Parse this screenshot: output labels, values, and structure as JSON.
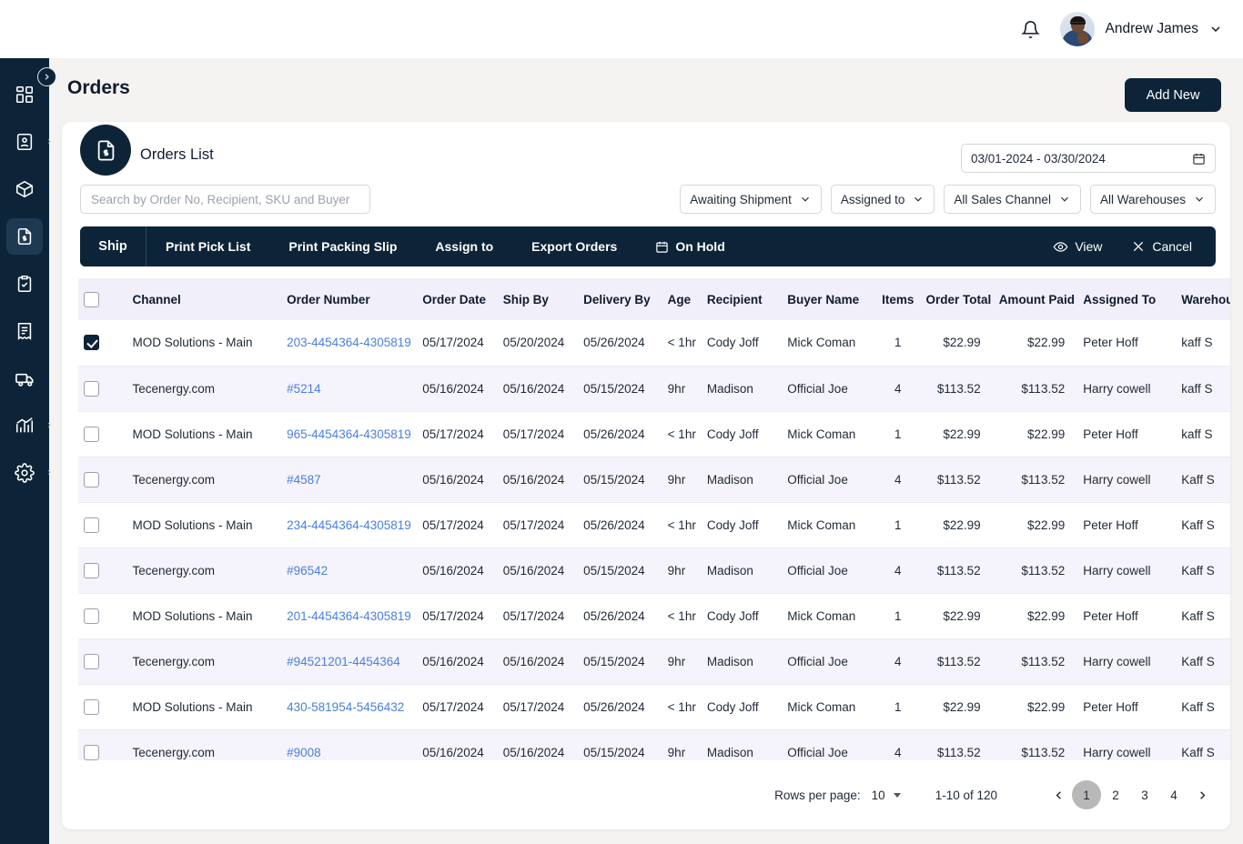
{
  "topbar": {
    "bell_icon": "bell-icon",
    "user_name": "Andrew James",
    "chevron_icon": "chevron-down-icon"
  },
  "sidebar": {
    "collapse_icon": "chevron-right-icon",
    "items": [
      {
        "icon": "dashboard-grid-icon",
        "active": false,
        "expandable": false
      },
      {
        "icon": "contact-card-icon",
        "active": false,
        "expandable": true
      },
      {
        "icon": "box-package-icon",
        "active": false,
        "expandable": false
      },
      {
        "icon": "invoice-document-icon",
        "active": true,
        "expandable": false
      },
      {
        "icon": "clipboard-check-icon",
        "active": false,
        "expandable": false
      },
      {
        "icon": "receipt-list-icon",
        "active": false,
        "expandable": false
      },
      {
        "icon": "delivery-truck-icon",
        "active": false,
        "expandable": false
      },
      {
        "icon": "analytics-chart-icon",
        "active": false,
        "expandable": true
      },
      {
        "icon": "gear-settings-icon",
        "active": false,
        "expandable": true
      }
    ]
  },
  "page": {
    "title": "Orders",
    "add_new_label": "Add New"
  },
  "card": {
    "icon": "orders-document-icon",
    "title": "Orders List",
    "date_range": "03/01-2024 - 03/30/2024",
    "calendar_icon": "calendar-icon"
  },
  "search": {
    "placeholder": "Search by Order No, Recipient, SKU and Buyer",
    "value": ""
  },
  "filters": [
    {
      "label": "Awaiting Shipment",
      "icon": "chevron-down-icon"
    },
    {
      "label": "Assigned to",
      "icon": "chevron-down-icon"
    },
    {
      "label": "All Sales Channel",
      "icon": "chevron-down-icon"
    },
    {
      "label": "All Warehouses",
      "icon": "chevron-down-icon"
    }
  ],
  "toolbar": {
    "ship_label": "Ship",
    "actions": [
      {
        "label": "Print Pick List",
        "icon": null
      },
      {
        "label": "Print Packing Slip",
        "icon": null
      },
      {
        "label": "Assign to",
        "icon": null
      },
      {
        "label": "Export Orders",
        "icon": null
      },
      {
        "label": "On Hold",
        "icon": "calendar-icon"
      }
    ],
    "right_actions": [
      {
        "label": "View",
        "icon": "eye-icon"
      },
      {
        "label": "Cancel",
        "icon": "close-x-icon"
      }
    ]
  },
  "table": {
    "columns": [
      "Channel",
      "Order Number",
      "Order Date",
      "Ship By",
      "Delivery By",
      "Age",
      "Recipient",
      "Buyer Name",
      "Items",
      "Order Total",
      "Amount Paid",
      "Assigned To",
      "Warehouse"
    ],
    "header_checkbox_checked": false,
    "rows": [
      {
        "checked": true,
        "channel": "MOD Solutions - Main",
        "order_number": "203-4454364-4305819",
        "order_date": "05/17/2024",
        "ship_by": "05/20/2024",
        "delivery_by": "05/26/2024",
        "age": "< 1hr",
        "recipient": "Cody Joff",
        "buyer_name": "Mick Coman",
        "items": "1",
        "order_total": "$22.99",
        "amount_paid": "$22.99",
        "assigned_to": "Peter Hoff",
        "warehouse": "kaff S"
      },
      {
        "checked": false,
        "channel": "Tecenergy.com",
        "order_number": "#5214",
        "order_date": "05/16/2024",
        "ship_by": "05/16/2024",
        "delivery_by": "05/15/2024",
        "age": "9hr",
        "recipient": "Madison",
        "buyer_name": "Official Joe",
        "items": "4",
        "order_total": "$113.52",
        "amount_paid": "$113.52",
        "assigned_to": "Harry cowell",
        "warehouse": "kaff S"
      },
      {
        "checked": false,
        "channel": "MOD Solutions - Main",
        "order_number": "965-4454364-4305819",
        "order_date": "05/17/2024",
        "ship_by": "05/17/2024",
        "delivery_by": "05/26/2024",
        "age": "< 1hr",
        "recipient": "Cody Joff",
        "buyer_name": "Mick Coman",
        "items": "1",
        "order_total": "$22.99",
        "amount_paid": "$22.99",
        "assigned_to": "Peter Hoff",
        "warehouse": "kaff S"
      },
      {
        "checked": false,
        "channel": "Tecenergy.com",
        "order_number": "#4587",
        "order_date": "05/16/2024",
        "ship_by": "05/16/2024",
        "delivery_by": "05/15/2024",
        "age": "9hr",
        "recipient": "Madison",
        "buyer_name": "Official Joe",
        "items": "4",
        "order_total": "$113.52",
        "amount_paid": "$113.52",
        "assigned_to": "Harry cowell",
        "warehouse": "Kaff S"
      },
      {
        "checked": false,
        "channel": "MOD Solutions - Main",
        "order_number": "234-4454364-4305819",
        "order_date": "05/17/2024",
        "ship_by": "05/17/2024",
        "delivery_by": "05/26/2024",
        "age": "< 1hr",
        "recipient": "Cody Joff",
        "buyer_name": "Mick Coman",
        "items": "1",
        "order_total": "$22.99",
        "amount_paid": "$22.99",
        "assigned_to": "Peter Hoff",
        "warehouse": "Kaff S"
      },
      {
        "checked": false,
        "channel": "Tecenergy.com",
        "order_number": "#96542",
        "order_date": "05/16/2024",
        "ship_by": "05/16/2024",
        "delivery_by": "05/15/2024",
        "age": "9hr",
        "recipient": "Madison",
        "buyer_name": "Official Joe",
        "items": "4",
        "order_total": "$113.52",
        "amount_paid": "$113.52",
        "assigned_to": "Harry cowell",
        "warehouse": "Kaff S"
      },
      {
        "checked": false,
        "channel": "MOD Solutions - Main",
        "order_number": "201-4454364-4305819",
        "order_date": "05/17/2024",
        "ship_by": "05/17/2024",
        "delivery_by": "05/26/2024",
        "age": "< 1hr",
        "recipient": "Cody Joff",
        "buyer_name": "Mick Coman",
        "items": "1",
        "order_total": "$22.99",
        "amount_paid": "$22.99",
        "assigned_to": "Peter Hoff",
        "warehouse": "Kaff S"
      },
      {
        "checked": false,
        "channel": "Tecenergy.com",
        "order_number": "#94521201-4454364",
        "order_date": "05/16/2024",
        "ship_by": "05/16/2024",
        "delivery_by": "05/15/2024",
        "age": "9hr",
        "recipient": "Madison",
        "buyer_name": "Official Joe",
        "items": "4",
        "order_total": "$113.52",
        "amount_paid": "$113.52",
        "assigned_to": "Harry cowell",
        "warehouse": "Kaff S"
      },
      {
        "checked": false,
        "channel": "MOD Solutions - Main",
        "order_number": "430-581954-5456432",
        "order_date": "05/17/2024",
        "ship_by": "05/17/2024",
        "delivery_by": "05/26/2024",
        "age": "< 1hr",
        "recipient": "Cody Joff",
        "buyer_name": "Mick Coman",
        "items": "1",
        "order_total": "$22.99",
        "amount_paid": "$22.99",
        "assigned_to": "Peter Hoff",
        "warehouse": "Kaff S"
      },
      {
        "checked": false,
        "channel": "Tecenergy.com",
        "order_number": "#9008",
        "order_date": "05/16/2024",
        "ship_by": "05/16/2024",
        "delivery_by": "05/15/2024",
        "age": "9hr",
        "recipient": "Madison",
        "buyer_name": "Official Joe",
        "items": "4",
        "order_total": "$113.52",
        "amount_paid": "$113.52",
        "assigned_to": "Harry cowell",
        "warehouse": "Kaff S"
      }
    ]
  },
  "pagination": {
    "rows_per_page_label": "Rows per page:",
    "rows_per_page_value": "10",
    "range_text": "1-10 of 120",
    "prev_icon": "chevron-left-icon",
    "next_icon": "chevron-right-icon",
    "pages": [
      "1",
      "2",
      "3",
      "4"
    ],
    "active_page": "1"
  },
  "colors": {
    "navy": "#0d2438",
    "link_blue": "#4a7fe0",
    "row_alt": "#f5f3fb",
    "header_bg": "#f1eff9",
    "page_bg": "#f4f3f1"
  }
}
